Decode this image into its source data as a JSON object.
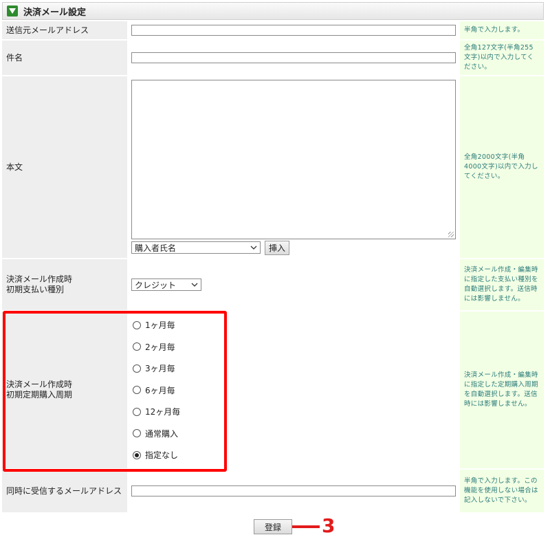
{
  "section": {
    "title": "決済メール設定"
  },
  "rows": {
    "sender": {
      "label": "送信元メールアドレス",
      "value": "",
      "hint": "半角で入力します。"
    },
    "subject": {
      "label": "件名",
      "value": "",
      "hint": "全角127文字(半角255文字)以内で入力してください。"
    },
    "body": {
      "label": "本文",
      "value": "",
      "hint": "全角2000文字(半角4000文字)以内で入力してください。",
      "insert_select": "購入者氏名",
      "insert_button": "挿入"
    },
    "payment_type": {
      "label_line1": "決済メール作成時",
      "label_line2": "初期支払い種別",
      "selected": "クレジット",
      "hint": "決済メール作成・編集時に指定した支払い種別を自動選択します。送信時には影響しません。"
    },
    "cycle": {
      "label_line1": "決済メール作成時",
      "label_line2": "初期定期購入周期",
      "options": [
        "1ヶ月毎",
        "2ヶ月毎",
        "3ヶ月毎",
        "6ヶ月毎",
        "12ヶ月毎",
        "通常購入",
        "指定なし"
      ],
      "checked_index": 6,
      "hint": "決済メール作成・編集時に指定した定期購入周期を自動選択します。送信時には影響しません。"
    },
    "cc": {
      "label": "同時に受信するメールアドレス",
      "value": "",
      "hint": "半角で入力します。この機能を使用しない場合は記入しないで下さい。"
    }
  },
  "submit": {
    "label": "登録"
  },
  "annotation": {
    "number": "3",
    "color": "#e21b1b"
  },
  "colors": {
    "label_bg": "#eeeeee",
    "hint_bg": "#f2ffe4",
    "hint_text": "#2a7a7a",
    "highlight": "#ff0000"
  }
}
